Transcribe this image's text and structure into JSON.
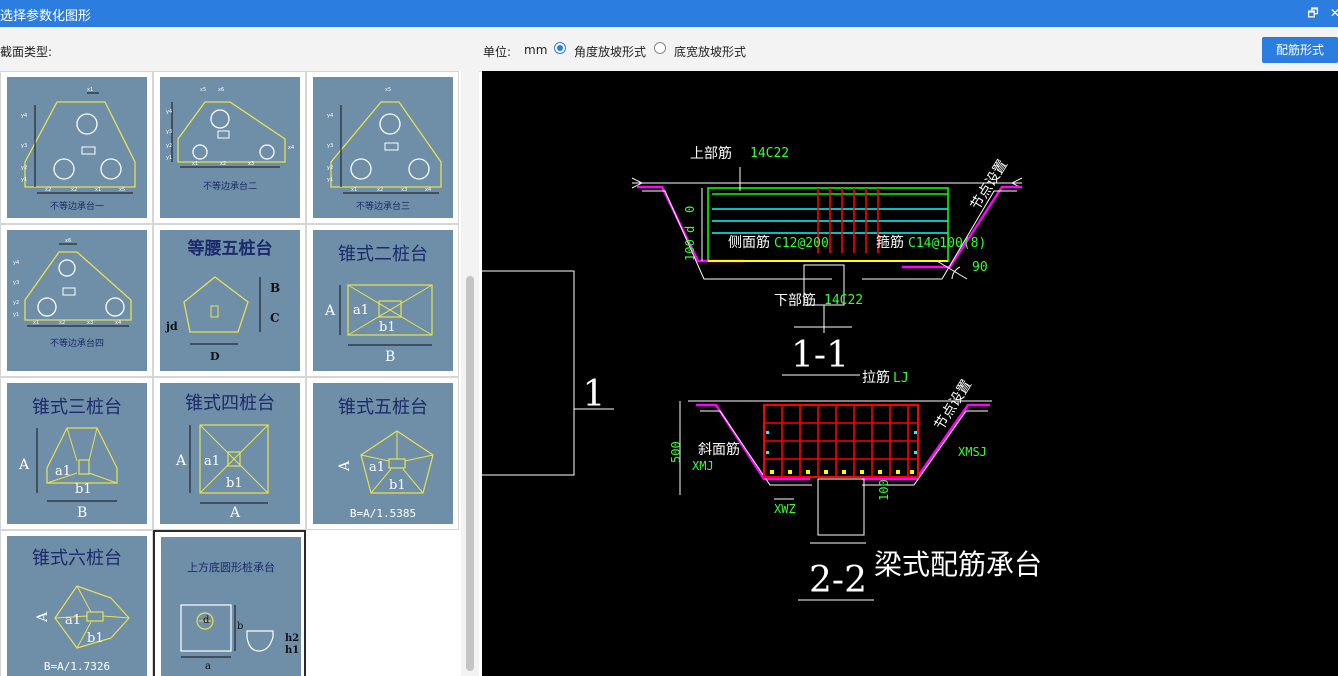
{
  "window": {
    "title": "选择参数化图形",
    "restore_glyph": "🗗",
    "close_glyph": "✕"
  },
  "toolbar": {
    "section_type_label": "截面类型:",
    "unit_label": "单位:",
    "unit_value": "mm",
    "radio_angle": "角度放坡形式",
    "radio_width": "底宽放坡形式",
    "selected_radio": "angle",
    "peijin_button": "配筋形式"
  },
  "shapes": [
    {
      "caption": "不等边承台一",
      "tags": [
        "y4",
        "y3",
        "y2",
        "y1",
        "x5",
        "x1",
        "x2",
        "x2",
        "x1"
      ]
    },
    {
      "caption": "不等边承台二",
      "tags": [
        "x5",
        "x6",
        "x1",
        "x2",
        "x3",
        "x4",
        "y4",
        "y3",
        "y2",
        "y1"
      ]
    },
    {
      "caption": "不等边承台三",
      "tags": [
        "x5",
        "y4",
        "y3",
        "y2",
        "y1",
        "x1",
        "x2",
        "x3",
        "x4"
      ]
    },
    {
      "caption": "不等边承台四",
      "tags": [
        "x6",
        "y4",
        "y3",
        "y2",
        "y1",
        "x1",
        "x2",
        "x3",
        "x4"
      ]
    },
    {
      "title": "等腰五桩台",
      "labels": [
        "B",
        "C",
        "jd",
        "D"
      ]
    },
    {
      "title": "锥式二桩台",
      "labels": [
        "A",
        "a1",
        "b1",
        "B"
      ]
    },
    {
      "title": "锥式三桩台",
      "labels": [
        "A",
        "a1",
        "b1",
        "B"
      ]
    },
    {
      "title": "锥式四桩台",
      "labels": [
        "A",
        "a1",
        "b1",
        "A"
      ]
    },
    {
      "title": "锥式五桩台",
      "labels": [
        "A",
        "a1",
        "b1",
        "B=A/1.5385"
      ]
    },
    {
      "title": "锥式六桩台",
      "labels": [
        "A",
        "a1",
        "b1",
        "B=A/1.7326"
      ]
    },
    {
      "title": "上方底圆形桩承台",
      "labels": [
        "d",
        "b",
        "a",
        "h2",
        "h1"
      ]
    }
  ],
  "preview": {
    "side_label": "1",
    "top_rebar": "上部筋",
    "top_rebar_val": "14C22",
    "side_rebar": "侧面筋",
    "side_rebar_val": "C12@200",
    "stirrup": "箍筋",
    "stirrup_val": "C14@100(8)",
    "bottom_rebar": "下部筋",
    "bottom_rebar_val": "14C22",
    "node_setting": "节点设置",
    "dim_top": "0",
    "dim_h": "100",
    "dim_d": "d",
    "angle_val": "90",
    "section_1": "1-1",
    "tie_rebar": "拉筋",
    "tie_rebar_val": "LJ",
    "slope_rebar": "斜面筋",
    "slope_rebar_code": "XMJ",
    "slope_code_right": "XMSJ",
    "dim_500": "500",
    "dim_100": "100",
    "xwz": "XWZ",
    "section_2": "2-2",
    "figure_title": "梁式配筋承台"
  },
  "colors": {
    "titlebar": "#2b7de0",
    "thumb_bg": "#6e8fa7",
    "shape_line": "#e8e052",
    "magenta": "#ff00ff",
    "green_rebar": "#00ff00",
    "cyan_rebar": "#00ffff",
    "red_rebar": "#ff0000",
    "yellow_rebar": "#ffff00",
    "label_green": "#33ff33"
  }
}
